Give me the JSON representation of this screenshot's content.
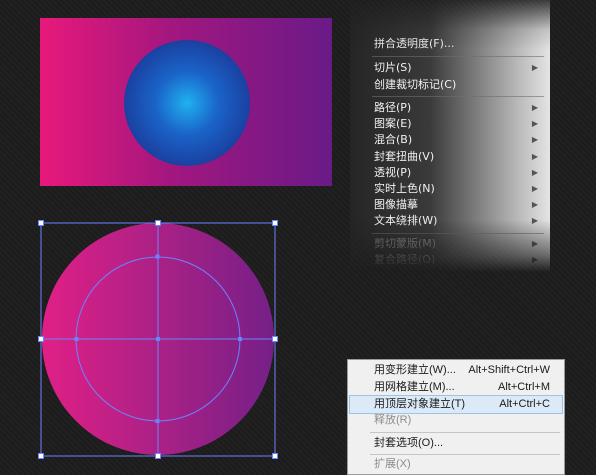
{
  "top_menu": {
    "items": [
      {
        "label": "拼合透明度(F)...",
        "arrow": false,
        "disabled": false
      },
      {
        "label": "切片(S)",
        "arrow": true,
        "disabled": false
      },
      {
        "label": "创建裁切标记(C)",
        "arrow": false,
        "disabled": false
      },
      {
        "label": "路径(P)",
        "arrow": true,
        "disabled": false
      },
      {
        "label": "图案(E)",
        "arrow": true,
        "disabled": false
      },
      {
        "label": "混合(B)",
        "arrow": true,
        "disabled": false
      },
      {
        "label": "封套扭曲(V)",
        "arrow": true,
        "disabled": false
      },
      {
        "label": "透视(P)",
        "arrow": true,
        "disabled": false
      },
      {
        "label": "实时上色(N)",
        "arrow": true,
        "disabled": false
      },
      {
        "label": "图像描摹",
        "arrow": true,
        "disabled": false
      },
      {
        "label": "文本绕排(W)",
        "arrow": true,
        "disabled": false
      },
      {
        "label": "剪切蒙版(M)",
        "arrow": true,
        "disabled": true
      },
      {
        "label": "复合路径(O)",
        "arrow": true,
        "disabled": true
      }
    ],
    "arrow_glyph": "▶"
  },
  "submenu": {
    "items": [
      {
        "label": "用变形建立(W)...",
        "shortcut": "Alt+Shift+Ctrl+W",
        "highlighted": false,
        "disabled": false
      },
      {
        "label": "用网格建立(M)...",
        "shortcut": "Alt+Ctrl+M",
        "highlighted": false,
        "disabled": false
      },
      {
        "label": "用顶层对象建立(T)",
        "shortcut": "Alt+Ctrl+C",
        "highlighted": true,
        "disabled": false
      },
      {
        "label": "释放(R)",
        "shortcut": "",
        "highlighted": false,
        "disabled": true
      },
      {
        "label": "封套选项(O)...",
        "shortcut": "",
        "highlighted": false,
        "disabled": false
      },
      {
        "label": "扩展(X)",
        "shortcut": "",
        "highlighted": false,
        "disabled": true
      }
    ]
  },
  "colors": {
    "selection": "#6c83ff",
    "highlight": "#dce9f7"
  }
}
